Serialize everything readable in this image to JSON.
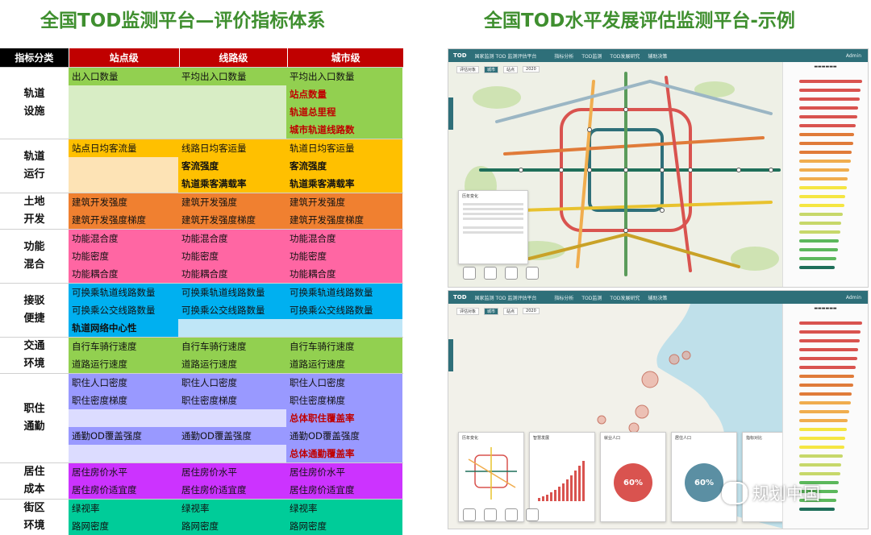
{
  "left_title": "全国TOD监测平台—评价指标体系",
  "right_title": "全国TOD水平发展评估监测平台-示例",
  "table": {
    "headers": [
      "指标分类",
      "站点级",
      "线路级",
      "城市级"
    ],
    "groups": [
      {
        "category": "轨道\n设施",
        "color": "#92d050",
        "light": "#d8edc5",
        "rows": [
          [
            {
              "t": "出入口数量"
            },
            {
              "t": "平均出入口数量"
            },
            {
              "t": "平均出入口数量"
            }
          ],
          [
            null,
            null,
            {
              "t": "站点数量",
              "s": "red"
            }
          ],
          [
            null,
            null,
            {
              "t": "轨道总里程",
              "s": "red"
            }
          ],
          [
            null,
            null,
            {
              "t": "城市轨道线路数",
              "s": "red"
            }
          ]
        ]
      },
      {
        "category": "轨道\n运行",
        "color": "#ffc000",
        "light": "#fde3b5",
        "rows": [
          [
            {
              "t": "站点日均客流量"
            },
            {
              "t": "线路日均客运量"
            },
            {
              "t": "轨道日均客运量"
            }
          ],
          [
            null,
            {
              "t": "客流强度",
              "s": "bold"
            },
            {
              "t": "客流强度",
              "s": "bold"
            }
          ],
          [
            null,
            {
              "t": "轨道乘客满载率",
              "s": "bold"
            },
            {
              "t": "轨道乘客满载率",
              "s": "bold"
            }
          ]
        ]
      },
      {
        "category": "土地\n开发",
        "color": "#f08030",
        "light": "#f08030",
        "rows": [
          [
            {
              "t": "建筑开发强度"
            },
            {
              "t": "建筑开发强度"
            },
            {
              "t": "建筑开发强度"
            }
          ],
          [
            {
              "t": "建筑开发强度梯度"
            },
            {
              "t": "建筑开发强度梯度"
            },
            {
              "t": "建筑开发强度梯度"
            }
          ]
        ]
      },
      {
        "category": "功能\n混合",
        "color": "#ff66a3",
        "light": "#ff66a3",
        "rows": [
          [
            {
              "t": "功能混合度"
            },
            {
              "t": "功能混合度"
            },
            {
              "t": "功能混合度"
            }
          ],
          [
            {
              "t": "功能密度"
            },
            {
              "t": "功能密度"
            },
            {
              "t": "功能密度"
            }
          ],
          [
            {
              "t": "功能耦合度"
            },
            {
              "t": "功能耦合度"
            },
            {
              "t": "功能耦合度"
            }
          ]
        ]
      },
      {
        "category": "接驳\n便捷",
        "color": "#00b0f0",
        "light": "#bfe6f7",
        "rows": [
          [
            {
              "t": "可换乘轨道线路数量"
            },
            {
              "t": "可换乘轨道线路数量"
            },
            {
              "t": "可换乘轨道线路数量"
            }
          ],
          [
            {
              "t": "可换乘公交线路数量"
            },
            {
              "t": "可换乘公交线路数量"
            },
            {
              "t": "可换乘公交线路数量"
            }
          ],
          [
            {
              "t": "轨道网络中心性",
              "s": "bold"
            },
            null,
            null
          ]
        ]
      },
      {
        "category": "交通\n环境",
        "color": "#92d050",
        "light": "#92d050",
        "rows": [
          [
            {
              "t": "自行车骑行速度"
            },
            {
              "t": "自行车骑行速度"
            },
            {
              "t": "自行车骑行速度"
            }
          ],
          [
            {
              "t": "道路运行速度"
            },
            {
              "t": "道路运行速度"
            },
            {
              "t": "道路运行速度"
            }
          ]
        ]
      },
      {
        "category": "职住\n通勤",
        "color": "#9999ff",
        "light": "#dcdcff",
        "rows": [
          [
            {
              "t": "职住人口密度"
            },
            {
              "t": "职住人口密度"
            },
            {
              "t": "职住人口密度"
            }
          ],
          [
            {
              "t": "职住密度梯度"
            },
            {
              "t": "职住密度梯度"
            },
            {
              "t": "职住密度梯度"
            }
          ],
          [
            null,
            null,
            {
              "t": "总体职住覆盖率",
              "s": "red"
            }
          ],
          [
            {
              "t": "通勤OD覆盖强度"
            },
            {
              "t": "通勤OD覆盖强度"
            },
            {
              "t": "通勤OD覆盖强度"
            }
          ],
          [
            null,
            null,
            {
              "t": "总体通勤覆盖率",
              "s": "red"
            }
          ]
        ]
      },
      {
        "category": "居住\n成本",
        "color": "#cc33ff",
        "light": "#cc33ff",
        "rows": [
          [
            {
              "t": "居住房价水平"
            },
            {
              "t": "居住房价水平"
            },
            {
              "t": "居住房价水平"
            }
          ],
          [
            {
              "t": "居住房价适宜度"
            },
            {
              "t": "居住房价适宜度"
            },
            {
              "t": "居住房价适宜度"
            }
          ]
        ]
      },
      {
        "category": "街区\n环境",
        "color": "#00cc99",
        "light": "#00cc99",
        "rows": [
          [
            {
              "t": "绿视率"
            },
            {
              "t": "绿视率"
            },
            {
              "t": "绿视率"
            }
          ],
          [
            {
              "t": "路网密度"
            },
            {
              "t": "路网密度"
            },
            {
              "t": "路网密度"
            }
          ]
        ]
      }
    ]
  },
  "platform": {
    "logo": "TOD",
    "app_name": "国家监测 TOD 监测评估平台",
    "nav": [
      "指标分析",
      "TOD监测",
      "TOD发展研究",
      "辅助决策"
    ],
    "user": "Admin",
    "filter": [
      "评估对象",
      "城市",
      "站点",
      "2020"
    ],
    "popup_title": "历年变化",
    "card_titles": [
      "历年变化",
      "智慧发展",
      "就业人口",
      "居住人口",
      "指标对比"
    ],
    "gauge_values": [
      "60%",
      "60%"
    ],
    "colors": {
      "teal": "#2e6f79",
      "red": "#d9534f",
      "orange": "#f0ad4e",
      "yellow": "#f5e642",
      "green": "#5cb85c",
      "darkgreen": "#1f6f5a"
    }
  },
  "watermark": "规划中国",
  "colors": {
    "title_green": "#3f8f2f",
    "header_red": "#c00000",
    "header_black": "#000000"
  }
}
